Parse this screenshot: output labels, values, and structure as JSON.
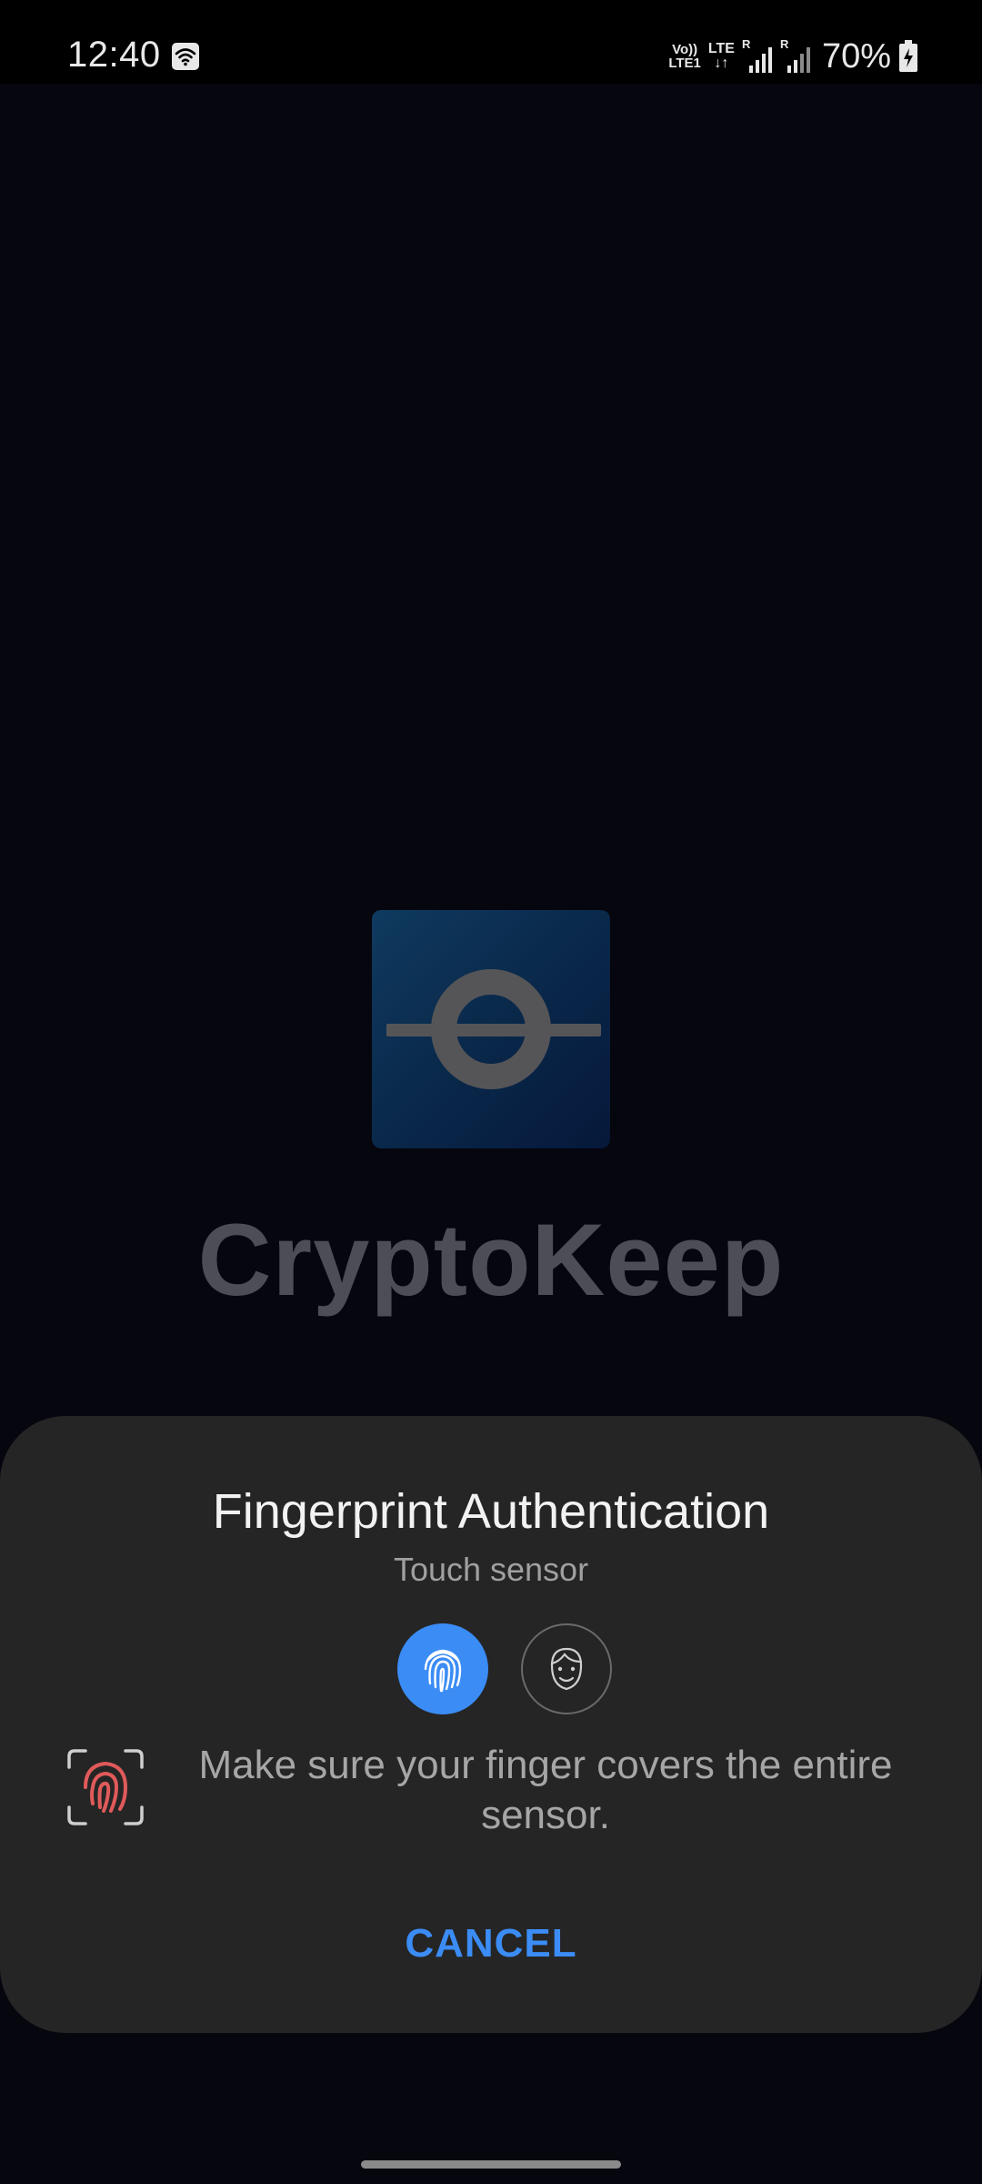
{
  "status_bar": {
    "time": "12:40",
    "volte_top": "Vo))",
    "volte_bottom": "LTE1",
    "lte_top": "LTE",
    "lte_arrows": "↓↑",
    "roaming_1": "R",
    "roaming_2": "R",
    "battery": "70%"
  },
  "splash": {
    "app_name": "CryptoKeep",
    "logo_icon": "crypto-ring-icon"
  },
  "auth_sheet": {
    "title": "Fingerprint Authentication",
    "subtitle": "Touch sensor",
    "methods": [
      {
        "icon": "fingerprint-icon",
        "selected": true
      },
      {
        "icon": "face-icon",
        "selected": false
      }
    ],
    "message": "Make sure your finger covers the entire sensor.",
    "cancel_label": "CANCEL"
  },
  "colors": {
    "accent": "#3b8cf5",
    "error": "#e05a5a",
    "sheet_bg": "#252525",
    "screen_bg": "#06060f"
  }
}
